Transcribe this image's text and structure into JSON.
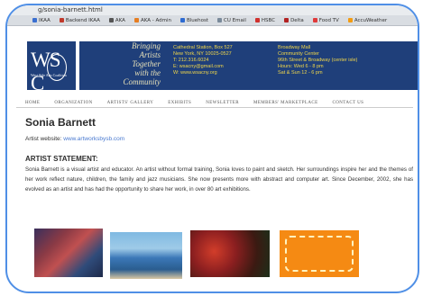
{
  "browser": {
    "url": "g/sonia-barnett.html",
    "bookmarks": [
      {
        "label": "IKAA",
        "color": "#3a6fd0"
      },
      {
        "label": "Backend IKAA",
        "color": "#c0392b"
      },
      {
        "label": "AKA",
        "color": "#555555"
      },
      {
        "label": "AKA - Admin",
        "color": "#e67e22"
      },
      {
        "label": "Bluehost",
        "color": "#2e6bd1"
      },
      {
        "label": "CU Email",
        "color": "#7a8a9a"
      },
      {
        "label": "HSBC",
        "color": "#d0312d"
      },
      {
        "label": "Delta",
        "color": "#b22222"
      },
      {
        "label": "Food TV",
        "color": "#e03a3a"
      },
      {
        "label": "AccuWeather",
        "color": "#f39c12"
      }
    ]
  },
  "site": {
    "logo_text": "WS C",
    "logo_sub": "West Side Arts Coalition",
    "tagline": [
      "Bringing",
      "Artists",
      "Together",
      "with the",
      "Community"
    ],
    "contact_left": [
      "Cathedral Station, Box 527",
      "New York, NY 10025-0527",
      "T: 212.316.6024",
      "E: wsacny@gmail.com",
      "W: www.wsacny.org"
    ],
    "contact_right": [
      "Broadway Mall",
      "Community Center",
      "96th Street & Broadway (center isle)",
      "Hours: Wed 6 - 8 pm",
      "Sat & Sun 12 - 6 pm"
    ]
  },
  "nav": {
    "items": [
      "HOME",
      "ORGANIZATION",
      "ARTISTS' GALLERY",
      "EXHIBITS",
      "NEWSLETTER",
      "MEMBERS' MARKETPLACE",
      "CONTACT US"
    ]
  },
  "artist": {
    "name": "Sonia Barnett",
    "website_label": "Artist website:",
    "website_url": "www.artworksbysb.com",
    "statement_title": "ARTIST STATEMENT:",
    "statement": "Sonia Barnett is a visual artist and educator.  An artist without formal training, Sonia loves to paint and sketch. Her surroundings inspire her and the themes of her work reflect nature, children, the family and jazz musicians. She now presents more with abstract and computer art. Since December, 2002, she has evolved as an artist and has had the opportunity to share her work, in over 80 art exhibitions."
  }
}
